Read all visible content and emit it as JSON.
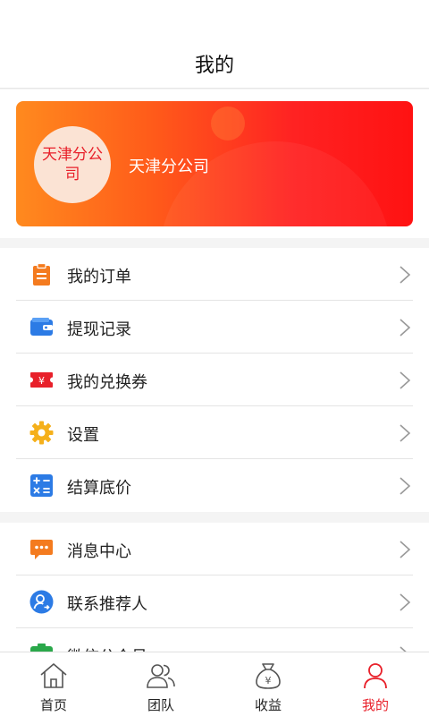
{
  "header": {
    "title": "我的"
  },
  "profile": {
    "avatar_text": "天津分公司",
    "name": "天津分公司"
  },
  "menu_group1": [
    {
      "label": "我的订单",
      "icon": "order-icon"
    },
    {
      "label": "提现记录",
      "icon": "wallet-icon"
    },
    {
      "label": "我的兑换券",
      "icon": "coupon-icon"
    },
    {
      "label": "设置",
      "icon": "gear-icon"
    },
    {
      "label": "结算底价",
      "icon": "calculator-icon"
    }
  ],
  "menu_group2": [
    {
      "label": "消息中心",
      "icon": "message-icon"
    },
    {
      "label": "联系推荐人",
      "icon": "contact-icon"
    },
    {
      "label": "微信公众号",
      "icon": "wechat-icon"
    }
  ],
  "tabbar": [
    {
      "label": "首页",
      "icon": "home-icon"
    },
    {
      "label": "团队",
      "icon": "team-icon"
    },
    {
      "label": "收益",
      "icon": "money-bag-icon"
    },
    {
      "label": "我的",
      "icon": "person-icon",
      "active": true
    }
  ],
  "colors": {
    "accent": "#e8202a",
    "card_start": "#ff8a1e",
    "card_end": "#ff1212"
  }
}
